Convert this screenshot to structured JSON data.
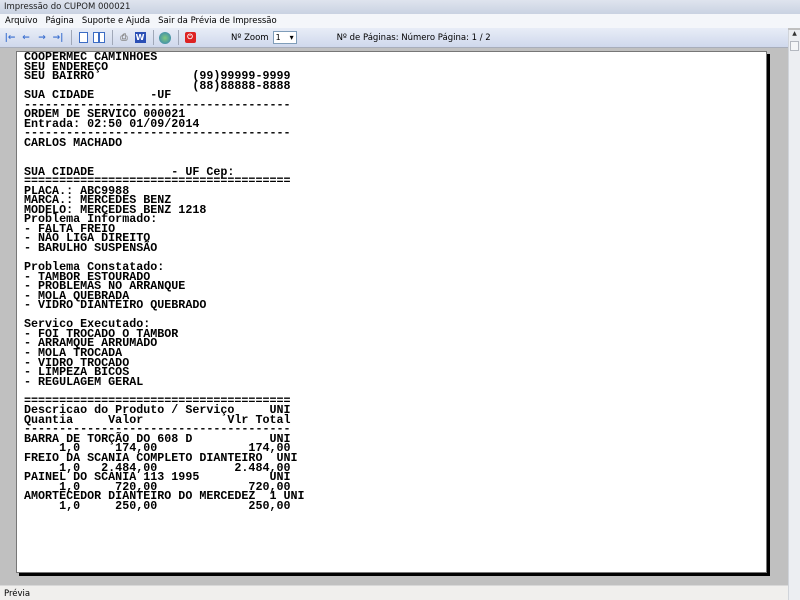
{
  "window": {
    "title": "Impressão do CUPOM 000021"
  },
  "menu": [
    "Arquivo",
    "Página",
    "Suporte e Ajuda",
    "Sair da Prévia de Impressão"
  ],
  "toolbar": {
    "icons": [
      "first-page-icon",
      "previous-page-icon",
      "next-page-icon",
      "last-page-icon",
      "single-page-icon",
      "two-pages-icon",
      "print-icon",
      "word-export-icon",
      "refresh-icon",
      "close-icon"
    ],
    "zoom_label": "Nº Zoom",
    "zoom_value": "1",
    "pages_label": "Nº de Páginas: Número Página: 1 / 2"
  },
  "report": {
    "lines": [
      "COOPERMEC CAMINHOES",
      "SEU ENDEREÇO",
      "SEU BAIRRO              (99)99999-9999",
      "                        (88)88888-8888",
      "SUA CIDADE        -UF",
      "--------------------------------------",
      "ORDEM DE SERVICO 000021",
      "Entrada: 02:50 01/09/2014",
      "--------------------------------------",
      "CARLOS MACHADO",
      "",
      "",
      "SUA CIDADE           - UF Cep:",
      "======================================",
      "PLACA.: ABC9988",
      "MARCA.: MERCEDES BENZ",
      "MODELO: MERCEDES BENZ 1218",
      "Problema Informado:",
      "- FALTA FREIO",
      "- NÃO LIGA DIREITO",
      "- BARULHO SUSPENSÃO",
      "",
      "Problema Constatado:",
      "- TAMBOR ESTOURADO",
      "- PROBLEMAS NO ARRANQUE",
      "- MOLA QUEBRADA",
      "- VIDRO DIANTEIRO QUEBRADO",
      "",
      "Servico Executado:",
      "- FOI TROCADO O TAMBOR",
      "- ARRAMQUE ARRUMADO",
      "- MOLA TROCADA",
      "- VIDRO TROCADO",
      "- LIMPEZA BICOS",
      "- REGULAGEM GERAL",
      "",
      "======================================",
      "Descricao do Produto / Serviço     UNI",
      "Quantia     Valor            Vlr Total",
      "--------------------------------------",
      "BARRA DE TORÇÃO DO 608 D           UNI",
      "     1,0     174,00             174,00",
      "FREIO DA SCANIA COMPLETO DIANTEIRO  UNI",
      "     1,0   2.484,00           2.484,00",
      "PAINEL DO SCANIA 113 1995          UNI",
      "     1,0     720,00             720,00",
      "AMORTECEDOR DIANTEIRO DO MERCEDEZ  1 UNI",
      "     1,0     250,00             250,00"
    ]
  },
  "status": {
    "text": "Prévia"
  }
}
